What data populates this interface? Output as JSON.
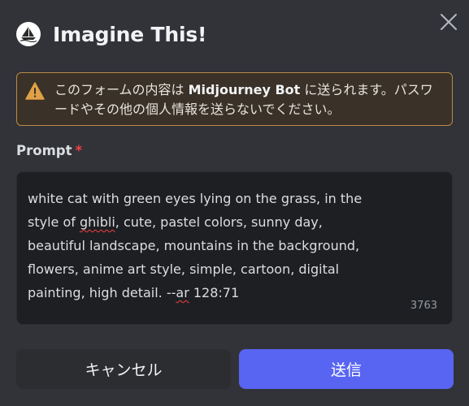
{
  "modal": {
    "title": "Imagine This!",
    "close_icon": "close-icon",
    "avatar_icon": "midjourney-boat-icon"
  },
  "warning": {
    "icon": "warning-triangle-icon",
    "text_before": "このフォームの内容は ",
    "bot_name": "Midjourney Bot",
    "text_after": " に送られます。パスワードやその他の個人情報を送らないでください。"
  },
  "prompt": {
    "label": "Prompt",
    "required_mark": "*",
    "text_part1": "white cat with green eyes lying on the grass, in the style of ",
    "text_misspelled1": "ghibli",
    "text_part2": ", cute, pastel colors, sunny day, beautiful landscape, mountains in the background, flowers, anime art style, simple, cartoon, digital painting, high detail. --",
    "text_misspelled2": "ar",
    "text_part3": " 128:71",
    "remaining_chars": "3763"
  },
  "buttons": {
    "cancel_label": "キャンセル",
    "submit_label": "送信"
  },
  "colors": {
    "background": "#313338",
    "input_background": "#1e1f22",
    "warning_border": "#b98a45",
    "warning_icon": "#e0a046",
    "primary_button": "#5865f2",
    "required_mark": "#f23f43"
  }
}
